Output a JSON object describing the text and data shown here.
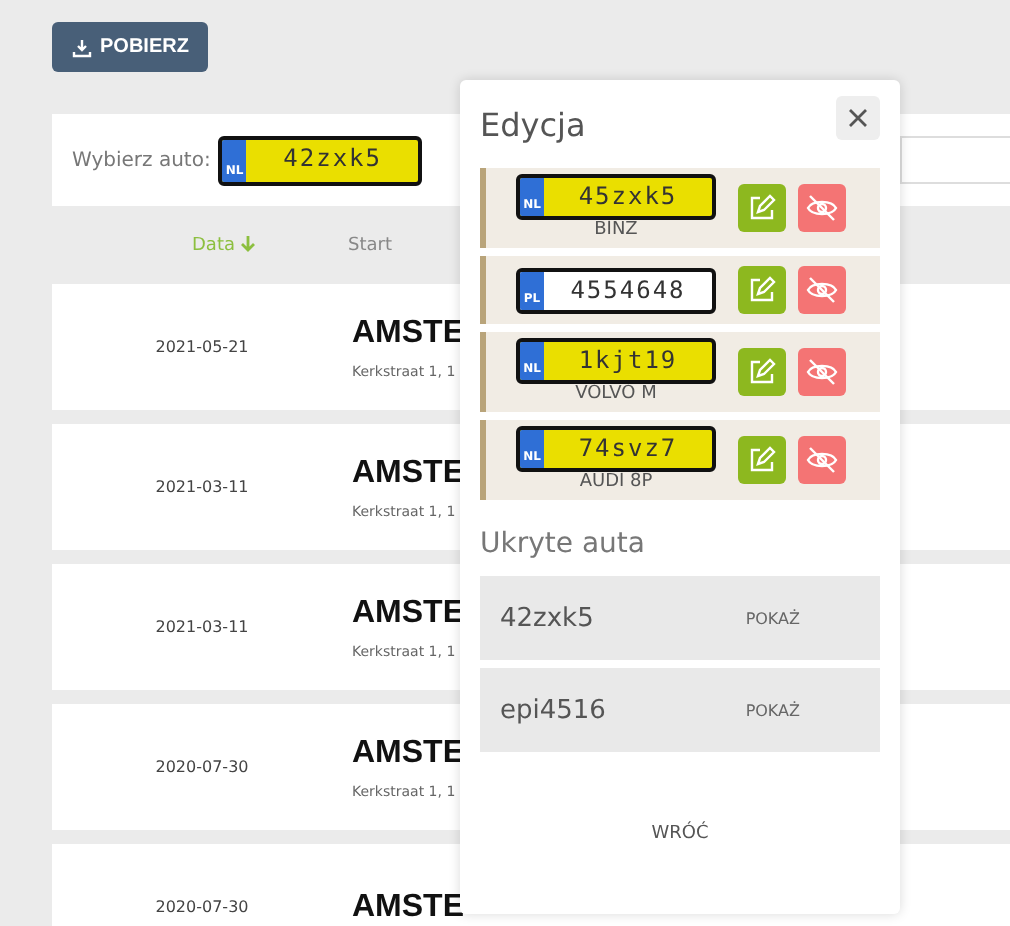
{
  "download_button": {
    "label": "POBIERZ"
  },
  "car_filter": {
    "label": "Wybierz auto:",
    "plate": {
      "country": "NL",
      "number": "42zxk5",
      "color": "#eadf00"
    }
  },
  "table": {
    "columns": [
      {
        "label": "Data",
        "sorted": true
      },
      {
        "label": "Start",
        "sorted": false
      }
    ],
    "rows": [
      {
        "date": "2021-05-21",
        "place": "AMSTE",
        "address": "Kerkstraat 1, 1"
      },
      {
        "date": "2021-03-11",
        "place": "AMSTE",
        "address": "Kerkstraat 1, 1"
      },
      {
        "date": "2021-03-11",
        "place": "AMSTE",
        "address": "Kerkstraat 1, 1"
      },
      {
        "date": "2020-07-30",
        "place": "AMSTE",
        "address": "Kerkstraat 1, 1"
      },
      {
        "date": "2020-07-30",
        "place": "AMSTE"
      }
    ]
  },
  "edit_panel": {
    "title": "Edycja",
    "cars": [
      {
        "country": "NL",
        "number": "45zxk5",
        "color": "#eadf00",
        "name": "BINZ"
      },
      {
        "country": "PL",
        "number": "4554648",
        "color": "#ffffff"
      },
      {
        "country": "NL",
        "number": "1kjt19",
        "color": "#eadf00",
        "name": "VOLVO M"
      },
      {
        "country": "NL",
        "number": "74svz7",
        "color": "#eadf00",
        "name": "AUDI 8P"
      }
    ],
    "hidden_title": "Ukryte auta",
    "hidden_cars": [
      {
        "number": "42zxk5",
        "action": "POKAŻ"
      },
      {
        "number": "epi4516",
        "action": "POKAŻ"
      }
    ],
    "back": "WRÓĆ"
  }
}
